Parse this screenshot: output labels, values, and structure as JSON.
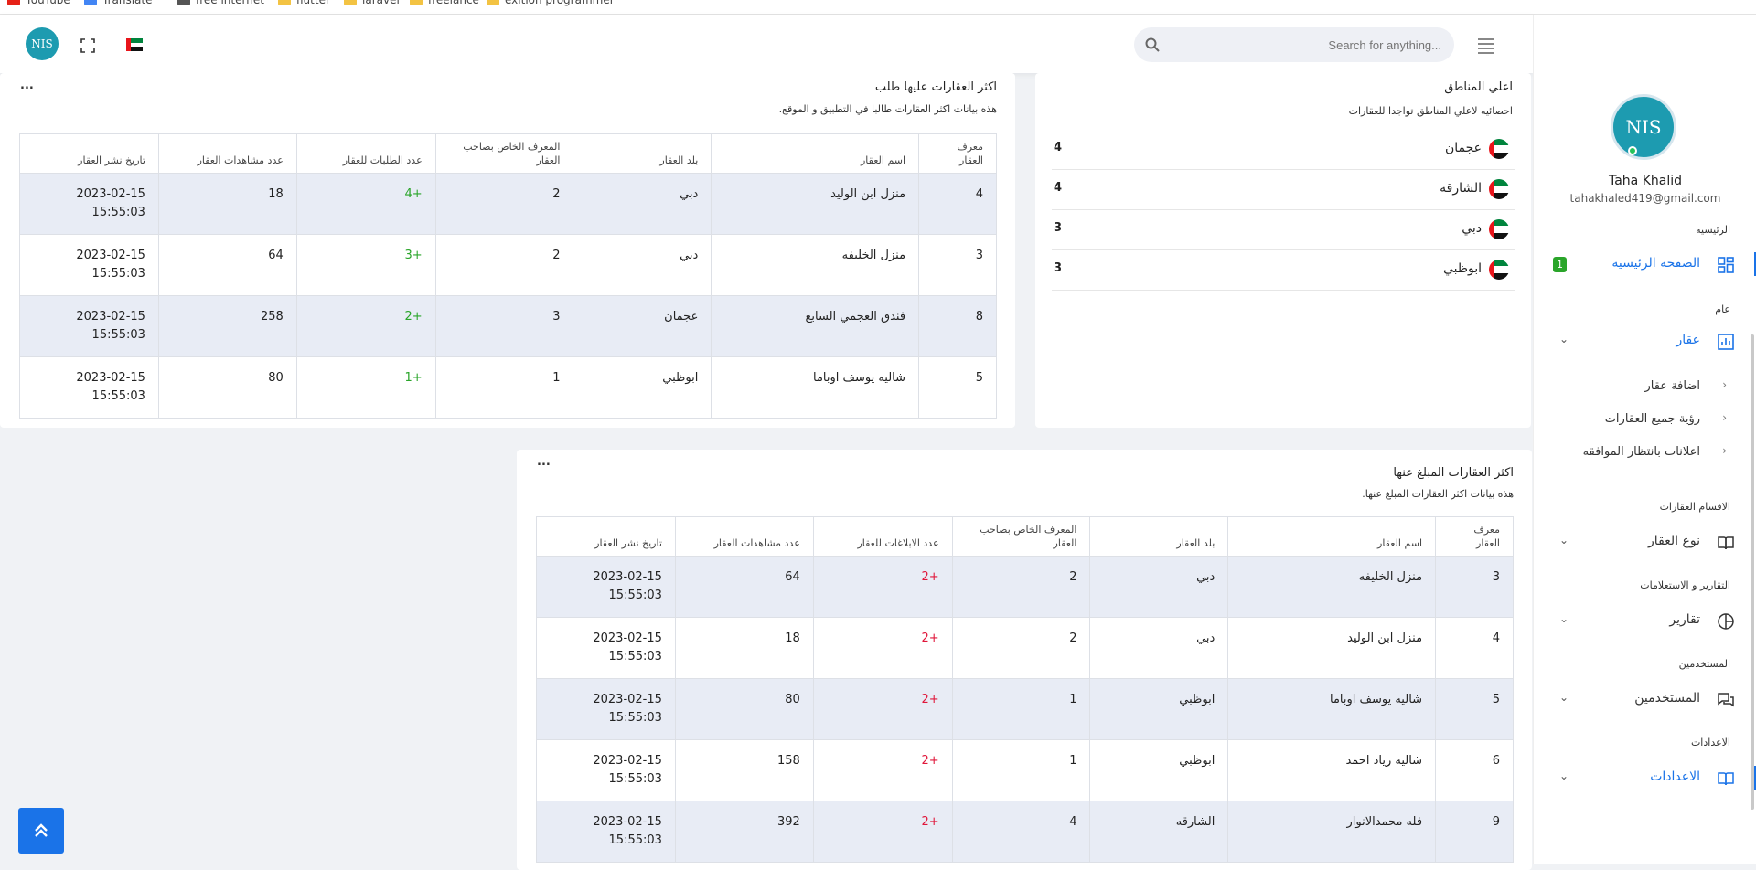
{
  "bookmarks": [
    {
      "label": "YouTube",
      "icon": "youtube-icon",
      "color": "#e62117"
    },
    {
      "label": "Translate",
      "icon": "translate-icon",
      "color": "#4285f4"
    },
    {
      "label": "free internet",
      "icon": "globe-icon",
      "color": "#555555"
    },
    {
      "label": "flutter",
      "icon": "folder-icon",
      "color": "#f3c343"
    },
    {
      "label": "laravel",
      "icon": "folder-icon",
      "color": "#f3c343"
    },
    {
      "label": "freelance",
      "icon": "folder-icon",
      "color": "#f3c343"
    },
    {
      "label": "exition programmer",
      "icon": "folder-icon",
      "color": "#f3c343"
    }
  ],
  "header": {
    "search_placeholder": "Search for anything...",
    "menu_icon": "hamburger-icon",
    "search_icon": "search-icon",
    "fullscreen_icon": "fullscreen-icon",
    "flag_icon": "uae-flag-icon",
    "logo_text": "NIS"
  },
  "colors": {
    "accent": "#1a73e8",
    "positive": "#2aa52a",
    "negative": "#e0163a",
    "row_stripe": "#e8ecf5"
  },
  "top_regions": {
    "title": "اعلي المناطق",
    "subtitle": "احصائيه لاعلي المناطق تواجدا للعقارات",
    "items": [
      {
        "name": "عجمان",
        "count": "4"
      },
      {
        "name": "الشارقه",
        "count": "4"
      },
      {
        "name": "دبي",
        "count": "3"
      },
      {
        "name": "ابوظبي",
        "count": "3"
      }
    ]
  },
  "most_requested": {
    "title": "اكثر العقارات عليها طلب",
    "subtitle": "هذه بيانات اكثر العقارات طالبا في التطبيق و الموقع.",
    "more": "...",
    "headers": [
      "معرف العقار",
      "اسم العقار",
      "بلد العقار",
      "المعرف الخاص بصاحب العقار",
      "عدد الطلبات للعقار",
      "عدد مشاهدات العقار",
      "تاريخ نشر العقار"
    ],
    "rows": [
      {
        "id": "4",
        "name": "منزل ابن الوليد",
        "country": "دبي",
        "owner": "2",
        "count": "+4",
        "views": "18",
        "date": "2023-02-15 15:55:03"
      },
      {
        "id": "3",
        "name": "منزل الخليفه",
        "country": "دبي",
        "owner": "2",
        "count": "+3",
        "views": "64",
        "date": "2023-02-15 15:55:03"
      },
      {
        "id": "8",
        "name": "فندق العجمي السابع",
        "country": "عجمان",
        "owner": "3",
        "count": "+2",
        "views": "258",
        "date": "2023-02-15 15:55:03"
      },
      {
        "id": "5",
        "name": "شاليه يوسف اوباما",
        "country": "ابوظبي",
        "owner": "1",
        "count": "+1",
        "views": "80",
        "date": "2023-02-15 15:55:03"
      }
    ]
  },
  "most_reported": {
    "title": "اكثر العقارات المبلغ عنها",
    "subtitle": "هذه بيانات اكثر العقارات المبلغ عنها.",
    "more": "...",
    "headers": [
      "معرف العقار",
      "اسم العقار",
      "بلد العقار",
      "المعرف الخاص بصاحب العقار",
      "عدد الابلاغات للعقار",
      "عدد مشاهدات العقار",
      "تاريخ نشر العقار"
    ],
    "rows": [
      {
        "id": "3",
        "name": "منزل الخليفه",
        "country": "دبي",
        "owner": "2",
        "count": "+2",
        "views": "64",
        "date": "2023-02-15 15:55:03"
      },
      {
        "id": "4",
        "name": "منزل ابن الوليد",
        "country": "دبي",
        "owner": "2",
        "count": "+2",
        "views": "18",
        "date": "2023-02-15 15:55:03"
      },
      {
        "id": "5",
        "name": "شاليه يوسف اوباما",
        "country": "ابوظبي",
        "owner": "1",
        "count": "+2",
        "views": "80",
        "date": "2023-02-15 15:55:03"
      },
      {
        "id": "6",
        "name": "شاليه زياد احمد",
        "country": "ابوظبي",
        "owner": "1",
        "count": "+2",
        "views": "158",
        "date": "2023-02-15 15:55:03"
      },
      {
        "id": "9",
        "name": "فله محمدالانوار",
        "country": "الشارقه",
        "owner": "4",
        "count": "+2",
        "views": "392",
        "date": "2023-02-15 15:55:03"
      }
    ]
  },
  "sidebar": {
    "user_name": "Taha Khalid",
    "user_email": "tahakhaled419@gmail.com",
    "logo_text": "NIS",
    "sections": {
      "home": "الرئيسيه",
      "general": "عام",
      "categories": "الاقسام العقارات",
      "reports": "التقارير و الاستعلامات",
      "users": "المستخدمين",
      "settings": "الاعدادات"
    },
    "home_item": {
      "label": "الصفحه الرئيسيه",
      "badge": "1",
      "icon": "dashboard-icon"
    },
    "property_item": {
      "label": "عقار",
      "icon": "bar-chart-icon"
    },
    "sub_items": [
      "اضافة عقار",
      "رؤية جميع العقارات",
      "اعلانات بانتظار الموافقه"
    ],
    "type_item": {
      "label": "نوع العقار",
      "icon": "book-icon"
    },
    "reports_item": {
      "label": "تقارير",
      "icon": "pie-chart-icon"
    },
    "users_item": {
      "label": "المستخدمين",
      "icon": "chat-icon"
    },
    "settings_item": {
      "label": "الاعدادات",
      "icon": "book-open-icon"
    }
  },
  "scroll_top": {
    "icon": "double-chevron-up-icon"
  }
}
